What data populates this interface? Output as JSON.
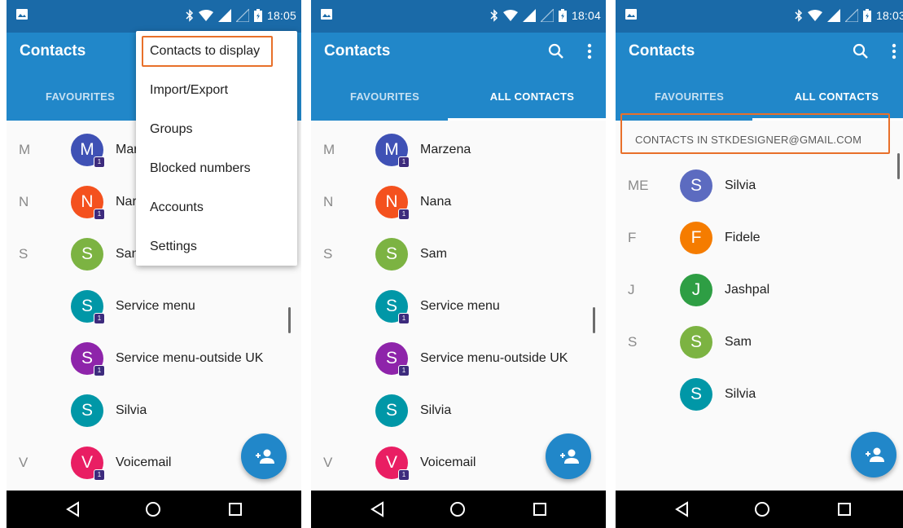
{
  "status_bar": {
    "time_left": "18:05",
    "time_middle": "18:04",
    "time_right": "18:03",
    "icons": [
      "image-icon",
      "bluetooth-icon",
      "wifi-icon",
      "signal-icon",
      "battery-icon"
    ]
  },
  "app": {
    "title": "Contacts",
    "tab_favourites": "FAVOURITES",
    "tab_all_contacts": "ALL CONTACTS"
  },
  "colors": {
    "status_bar": "#1a6aa8",
    "app_bar": "#2187c9",
    "highlight": "#e8702a",
    "background": "#fafafa"
  },
  "overflow_menu": {
    "items": [
      "Contacts to display",
      "Import/Export",
      "Groups",
      "Blocked numbers",
      "Accounts",
      "Settings"
    ]
  },
  "contacts_full": [
    {
      "section": "M",
      "initial": "M",
      "name": "Marzena",
      "color": "#3f51b5",
      "badge": "1"
    },
    {
      "section": "N",
      "initial": "N",
      "name": "Nana",
      "color": "#f4511e",
      "badge": "1"
    },
    {
      "section": "S",
      "initial": "S",
      "name": "Sam",
      "color": "#7cb342",
      "badge": ""
    },
    {
      "section": "",
      "initial": "S",
      "name": "Service menu",
      "color": "#0097a7",
      "badge": "1"
    },
    {
      "section": "",
      "initial": "S",
      "name": "Service menu-outside UK",
      "color": "#8e24aa",
      "badge": "1"
    },
    {
      "section": "",
      "initial": "S",
      "name": "Silvia",
      "color": "#0097a7",
      "badge": ""
    },
    {
      "section": "V",
      "initial": "V",
      "name": "Voicemail",
      "color": "#e91e63",
      "badge": "1"
    }
  ],
  "contacts_partial_names": [
    "Mar",
    "Nar",
    "San"
  ],
  "account_filter": {
    "label": "CONTACTS IN STKDESIGNER@GMAIL.COM"
  },
  "contacts_account": [
    {
      "section": "ME",
      "initial": "S",
      "name": "Silvia",
      "color": "#5c6bc0"
    },
    {
      "section": "F",
      "initial": "F",
      "name": "Fidele",
      "color": "#f57c00"
    },
    {
      "section": "J",
      "initial": "J",
      "name": "Jashpal",
      "color": "#2e9e44"
    },
    {
      "section": "S",
      "initial": "S",
      "name": "Sam",
      "color": "#7cb342"
    },
    {
      "section": "",
      "initial": "S",
      "name": "Silvia",
      "color": "#0097a7"
    }
  ],
  "fab_icon": "add-contact-icon",
  "nav_icons": [
    "back-icon",
    "home-icon",
    "recents-icon"
  ]
}
